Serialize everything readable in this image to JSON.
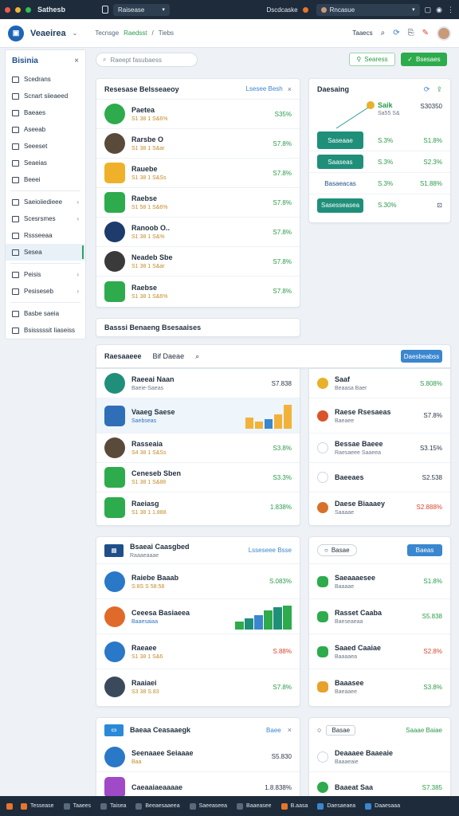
{
  "window": {
    "title": "Sathesb",
    "tab_label": "Raisease",
    "addr_label": "Dscdcaske",
    "profile_label": "Rncasue"
  },
  "app": {
    "brand": "Veaeirea",
    "breadcrumb": [
      "Tecnsge",
      "Raedsst",
      "Tiebs"
    ],
    "account_label": "Taaecs"
  },
  "sidebar": {
    "title": "Bisinia",
    "items": [
      {
        "label": "Scedrans",
        "chev": false
      },
      {
        "label": "Scnart siieaeed",
        "chev": false
      },
      {
        "label": "Baeaes",
        "chev": false
      },
      {
        "label": "Aseeab",
        "chev": false
      },
      {
        "label": "Seeeset",
        "chev": false
      },
      {
        "label": "Seaeias",
        "chev": false
      },
      {
        "label": "Beeei",
        "chev": false
      },
      {
        "label": "Saeioiiedieee",
        "chev": true
      },
      {
        "label": "Scesrsmes",
        "chev": true
      },
      {
        "label": "Rssseeaa",
        "chev": false
      },
      {
        "label": "Sesea",
        "chev": false,
        "active": true
      },
      {
        "label": "Peisis",
        "chev": true
      },
      {
        "label": "Pesiseseb",
        "chev": true
      },
      {
        "label": "Basbe saeia",
        "chev": false
      },
      {
        "label": "Bsisssssit Iiaseiss",
        "chev": false
      }
    ]
  },
  "toolbar": {
    "search_placeholder": "Raeept fasubaess",
    "filter_label": "Searess",
    "primary_label": "Bsesaes"
  },
  "people": {
    "title": "Resesase Belsseaeoy",
    "link": "Lsesee Besh",
    "rows": [
      {
        "name": "Paetea",
        "sub": "S1 38 1 S&6%",
        "value": "S35%",
        "color": "#2eab4c"
      },
      {
        "name": "Rarsbe O",
        "sub": "S1 38 1 S&ar",
        "value": "S7.8%",
        "color": "#5a4a3a"
      },
      {
        "name": "Rauebe",
        "sub": "S1 38 1 S&Ss",
        "value": "S7.8%",
        "color": "#f0b12a"
      },
      {
        "name": "Raebse",
        "sub": "S1 58 1 S&6%",
        "value": "S7.8%",
        "color": "#2eab4c"
      },
      {
        "name": "Ranoob O..",
        "sub": "S1 38 1 S&%",
        "value": "S7.8%",
        "color": "#1d3b6c"
      },
      {
        "name": "Neadeb Sbe",
        "sub": "S1 38 1 S&ar",
        "value": "S7.8%",
        "color": "#3a3a3a"
      },
      {
        "name": "Raebse",
        "sub": "S1 38 1 S&6%",
        "value": "S7.8%",
        "color": "#2eab4c"
      }
    ]
  },
  "details": {
    "title": "Daesaing",
    "top_label": "Saik",
    "top_sub": "Sa55 S&",
    "top_value": "S30350",
    "rows": [
      {
        "pill": "Saseaae",
        "mid": "S.3%",
        "value": "S1.8%"
      },
      {
        "pill": "Saaseas",
        "mid": "S.3%",
        "value": "S2.3%"
      },
      {
        "pill": "Basaeacas",
        "mid": "S.3%",
        "value": "S1.88%"
      },
      {
        "pill": "Sasesseasea",
        "mid": "S.30%",
        "value": ""
      }
    ]
  },
  "section_title": "Basssi Benaeng Bsesaaises",
  "feed": {
    "tab1": "Raesaaeee",
    "tab2": "Bif Daeae",
    "button": "Daesbeabss",
    "rows": [
      {
        "name": "Raeeai Naan",
        "sub": "Baeie-Saeas",
        "value": "S7.838",
        "color": "#1f8f7a"
      },
      {
        "name": "Vaaeg Saese",
        "sub": "Saebseas",
        "value": "",
        "color": "#2f6fb8"
      },
      {
        "name": "Rasseaia",
        "sub": "S4 38 1 S&Ss",
        "value": "S3.8%",
        "color": "#5a4a3a"
      },
      {
        "name": "Ceneseb Sben",
        "sub": "S1 38 1 S&88",
        "value": "S3.3%",
        "color": "#2eab4c"
      },
      {
        "name": "Raeiasg",
        "sub": "S1 38 1 1.888",
        "value": "1.838%",
        "color": "#2eab4c"
      }
    ],
    "bars": [
      14,
      9,
      12,
      18,
      30
    ]
  },
  "alerts": {
    "rows": [
      {
        "name": "Saaf",
        "sub": "Beaasa Baer",
        "value": "S.808%",
        "color": "#e8b12a"
      },
      {
        "name": "Raese Rsesaeas",
        "sub": "Baeaee",
        "value": "S7.8%",
        "color": "#d9542a"
      },
      {
        "name": "Bessae Baeee",
        "sub": "Raesaeee Saaeea",
        "value": "S3.15%",
        "color": ""
      },
      {
        "name": "Baeeaes",
        "sub": "",
        "value": "S2.538",
        "color": ""
      },
      {
        "name": "Daese Biaaaey",
        "sub": "Saaaae",
        "value": "S2.888%",
        "color": "#d9702a"
      }
    ]
  },
  "growth": {
    "title": "Bsaeai Caasgbed",
    "sub": "Raaaeaaae",
    "link": "Lsseseee Bsse",
    "rows": [
      {
        "name": "Raiebe Baaab",
        "sub": "S:8S S 58:58",
        "value": "S.083%",
        "color": "#2a78c8"
      },
      {
        "name": "Ceeesa Basiaeea",
        "sub": "Baaesaiaa",
        "value": "",
        "color": "#e06a2a"
      },
      {
        "name": "Raeaee",
        "sub": "S1 38 1 S&6",
        "value": "S.88%",
        "color": "#2a78c8"
      },
      {
        "name": "Raaiaei",
        "sub": "S3 38 S.83",
        "value": "S7.8%",
        "color": "#3a4a5c"
      }
    ],
    "bars": [
      10,
      14,
      18,
      24,
      28,
      30
    ]
  },
  "ledger": {
    "tab": "Basae",
    "button": "Baeas",
    "rows": [
      {
        "name": "Saeaaaesee",
        "sub": "Baaaae",
        "value": "S1.8%",
        "color": "#2eab4c"
      },
      {
        "name": "Rasset Caaba",
        "sub": "Baeseaeaa",
        "value": "S5.838",
        "color": "#2eab4c"
      },
      {
        "name": "Saaed Caaiae",
        "sub": "Baaaaea",
        "value": "S2.8%",
        "color": "#2eab4c"
      },
      {
        "name": "Baaasee",
        "sub": "Baeaaee",
        "value": "S3.8%",
        "color": "#e8a12a"
      }
    ]
  },
  "recent": {
    "title": "Baeaa Ceasaaegk",
    "link": "Baee",
    "rows": [
      {
        "name": "Seenaaee Seiaaae",
        "sub": "Baa",
        "value": "S5.830",
        "color": "#2a78c8"
      },
      {
        "name": "Caeaaiaeaaaae",
        "sub": "",
        "value": "1.8.838%",
        "color": "#a04ac8"
      }
    ]
  },
  "contacts": {
    "tab": "Basae",
    "link": "Saaae Baiae",
    "rows": [
      {
        "name": "Deaaaee Baaeaie",
        "sub": "Baaaeaie",
        "value": "",
        "color": ""
      },
      {
        "name": "Baaeat Saa",
        "sub": "",
        "value": "S7.385",
        "color": "#2eab4c"
      }
    ]
  },
  "taskbar": {
    "items": [
      "Tessease",
      "Taaees",
      "Taisea",
      "Beeaesaaeea",
      "Saeeaseea",
      "Baaeasee",
      "B.aasa",
      "Daesaeaea",
      "Daaesaaa"
    ]
  }
}
